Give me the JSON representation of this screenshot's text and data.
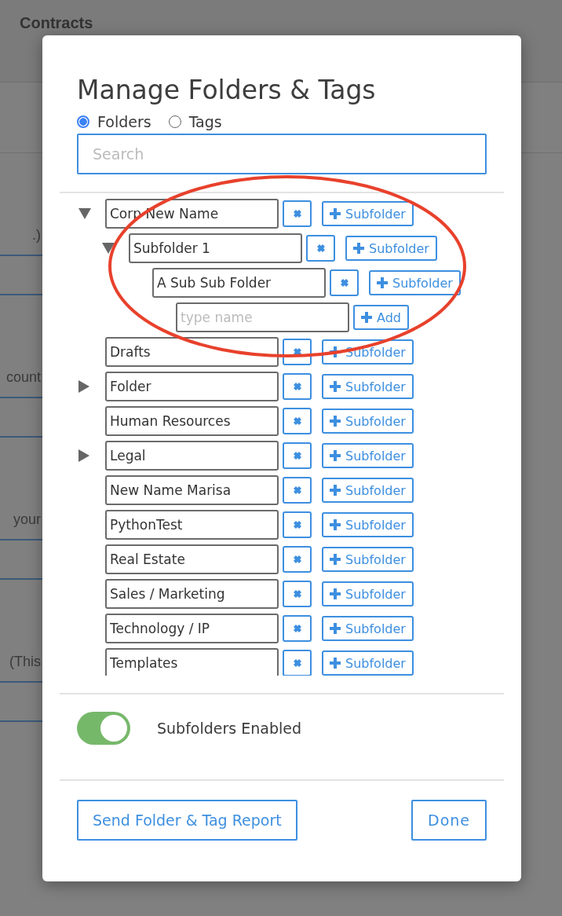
{
  "background": {
    "title": "Contracts",
    "row_texts": [
      ".)",
      "count",
      "your",
      "(This"
    ]
  },
  "dialog": {
    "title": "Manage Folders & Tags",
    "modes": [
      {
        "label": "Folders",
        "selected": true
      },
      {
        "label": "Tags",
        "selected": false
      }
    ],
    "search": {
      "placeholder": "Search"
    },
    "folders": [
      {
        "name": "Corp New Name",
        "expanded": true,
        "button": "Subfolder",
        "children": [
          {
            "name": "Subfolder 1",
            "expanded": true,
            "button": "Subfolder",
            "children": [
              {
                "name": "A Sub Sub Folder",
                "button": "Subfolder",
                "new_subfolder": {
                  "placeholder": "type name",
                  "button": "Add"
                }
              }
            ]
          }
        ]
      },
      {
        "name": "Drafts",
        "button": "Subfolder"
      },
      {
        "name": "Folder",
        "expanded": false,
        "button": "Subfolder"
      },
      {
        "name": "Human Resources",
        "button": "Subfolder"
      },
      {
        "name": "Legal",
        "expanded": false,
        "button": "Subfolder"
      },
      {
        "name": "New Name Marisa",
        "button": "Subfolder"
      },
      {
        "name": "PythonTest",
        "button": "Subfolder"
      },
      {
        "name": "Real Estate",
        "button": "Subfolder"
      },
      {
        "name": "Sales / Marketing",
        "button": "Subfolder"
      },
      {
        "name": "Technology / IP",
        "button": "Subfolder"
      },
      {
        "name": "Templates",
        "button": "Subfolder"
      }
    ],
    "subfolders_toggle": {
      "label": "Subfolders Enabled",
      "on": true
    },
    "buttons": [
      {
        "label": "Send Folder & Tag Report",
        "kind": "report"
      },
      {
        "label": "Done",
        "kind": "done"
      }
    ]
  },
  "annotation": {
    "kind": "ellipse",
    "color": "#e8412c"
  }
}
